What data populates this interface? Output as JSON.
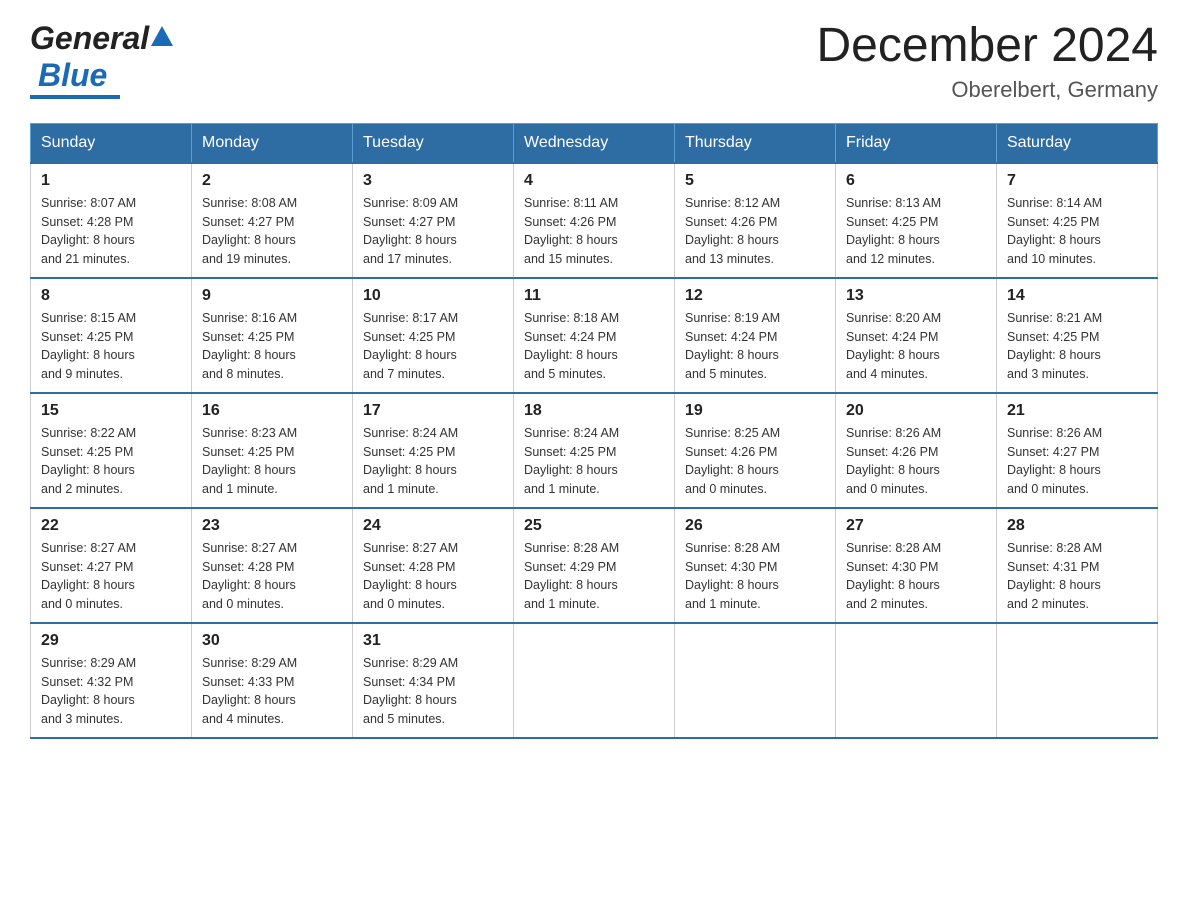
{
  "header": {
    "logo_general": "General",
    "logo_blue": "Blue",
    "month_title": "December 2024",
    "location": "Oberelbert, Germany"
  },
  "columns": [
    "Sunday",
    "Monday",
    "Tuesday",
    "Wednesday",
    "Thursday",
    "Friday",
    "Saturday"
  ],
  "weeks": [
    [
      {
        "day": "1",
        "sunrise": "8:07 AM",
        "sunset": "4:28 PM",
        "daylight": "8 hours and 21 minutes."
      },
      {
        "day": "2",
        "sunrise": "8:08 AM",
        "sunset": "4:27 PM",
        "daylight": "8 hours and 19 minutes."
      },
      {
        "day": "3",
        "sunrise": "8:09 AM",
        "sunset": "4:27 PM",
        "daylight": "8 hours and 17 minutes."
      },
      {
        "day": "4",
        "sunrise": "8:11 AM",
        "sunset": "4:26 PM",
        "daylight": "8 hours and 15 minutes."
      },
      {
        "day": "5",
        "sunrise": "8:12 AM",
        "sunset": "4:26 PM",
        "daylight": "8 hours and 13 minutes."
      },
      {
        "day": "6",
        "sunrise": "8:13 AM",
        "sunset": "4:25 PM",
        "daylight": "8 hours and 12 minutes."
      },
      {
        "day": "7",
        "sunrise": "8:14 AM",
        "sunset": "4:25 PM",
        "daylight": "8 hours and 10 minutes."
      }
    ],
    [
      {
        "day": "8",
        "sunrise": "8:15 AM",
        "sunset": "4:25 PM",
        "daylight": "8 hours and 9 minutes."
      },
      {
        "day": "9",
        "sunrise": "8:16 AM",
        "sunset": "4:25 PM",
        "daylight": "8 hours and 8 minutes."
      },
      {
        "day": "10",
        "sunrise": "8:17 AM",
        "sunset": "4:25 PM",
        "daylight": "8 hours and 7 minutes."
      },
      {
        "day": "11",
        "sunrise": "8:18 AM",
        "sunset": "4:24 PM",
        "daylight": "8 hours and 5 minutes."
      },
      {
        "day": "12",
        "sunrise": "8:19 AM",
        "sunset": "4:24 PM",
        "daylight": "8 hours and 5 minutes."
      },
      {
        "day": "13",
        "sunrise": "8:20 AM",
        "sunset": "4:24 PM",
        "daylight": "8 hours and 4 minutes."
      },
      {
        "day": "14",
        "sunrise": "8:21 AM",
        "sunset": "4:25 PM",
        "daylight": "8 hours and 3 minutes."
      }
    ],
    [
      {
        "day": "15",
        "sunrise": "8:22 AM",
        "sunset": "4:25 PM",
        "daylight": "8 hours and 2 minutes."
      },
      {
        "day": "16",
        "sunrise": "8:23 AM",
        "sunset": "4:25 PM",
        "daylight": "8 hours and 1 minute."
      },
      {
        "day": "17",
        "sunrise": "8:24 AM",
        "sunset": "4:25 PM",
        "daylight": "8 hours and 1 minute."
      },
      {
        "day": "18",
        "sunrise": "8:24 AM",
        "sunset": "4:25 PM",
        "daylight": "8 hours and 1 minute."
      },
      {
        "day": "19",
        "sunrise": "8:25 AM",
        "sunset": "4:26 PM",
        "daylight": "8 hours and 0 minutes."
      },
      {
        "day": "20",
        "sunrise": "8:26 AM",
        "sunset": "4:26 PM",
        "daylight": "8 hours and 0 minutes."
      },
      {
        "day": "21",
        "sunrise": "8:26 AM",
        "sunset": "4:27 PM",
        "daylight": "8 hours and 0 minutes."
      }
    ],
    [
      {
        "day": "22",
        "sunrise": "8:27 AM",
        "sunset": "4:27 PM",
        "daylight": "8 hours and 0 minutes."
      },
      {
        "day": "23",
        "sunrise": "8:27 AM",
        "sunset": "4:28 PM",
        "daylight": "8 hours and 0 minutes."
      },
      {
        "day": "24",
        "sunrise": "8:27 AM",
        "sunset": "4:28 PM",
        "daylight": "8 hours and 0 minutes."
      },
      {
        "day": "25",
        "sunrise": "8:28 AM",
        "sunset": "4:29 PM",
        "daylight": "8 hours and 1 minute."
      },
      {
        "day": "26",
        "sunrise": "8:28 AM",
        "sunset": "4:30 PM",
        "daylight": "8 hours and 1 minute."
      },
      {
        "day": "27",
        "sunrise": "8:28 AM",
        "sunset": "4:30 PM",
        "daylight": "8 hours and 2 minutes."
      },
      {
        "day": "28",
        "sunrise": "8:28 AM",
        "sunset": "4:31 PM",
        "daylight": "8 hours and 2 minutes."
      }
    ],
    [
      {
        "day": "29",
        "sunrise": "8:29 AM",
        "sunset": "4:32 PM",
        "daylight": "8 hours and 3 minutes."
      },
      {
        "day": "30",
        "sunrise": "8:29 AM",
        "sunset": "4:33 PM",
        "daylight": "8 hours and 4 minutes."
      },
      {
        "day": "31",
        "sunrise": "8:29 AM",
        "sunset": "4:34 PM",
        "daylight": "8 hours and 5 minutes."
      },
      null,
      null,
      null,
      null
    ]
  ],
  "labels": {
    "sunrise": "Sunrise:",
    "sunset": "Sunset:",
    "daylight": "Daylight:"
  }
}
